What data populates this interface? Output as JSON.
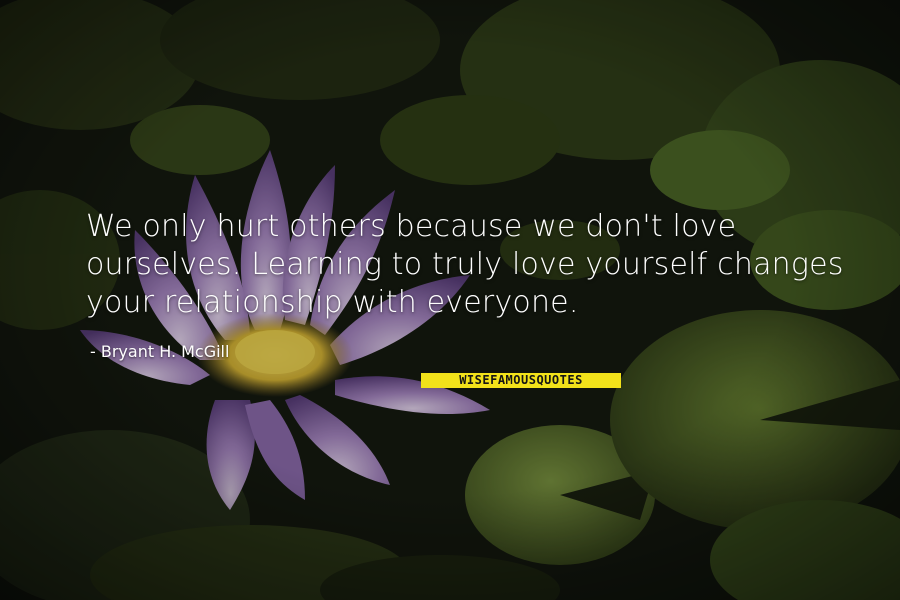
{
  "quote": {
    "lines": [
      "We only hurt others because we don't love",
      "ourselves. Learning to truly love yourself changes",
      "your relationship with everyone."
    ],
    "author_line": "- Bryant H. McGill"
  },
  "branding": {
    "logo_text": "WISEFAMOUSQUOTES"
  },
  "colors": {
    "text": "#ffffff",
    "logo_background": "#f2e21a",
    "logo_text": "#151515",
    "backdrop": "#141810",
    "lily_petal": "#8a6aa8",
    "lily_center": "#e2c441",
    "lily_pad": "#5f7a2c"
  }
}
